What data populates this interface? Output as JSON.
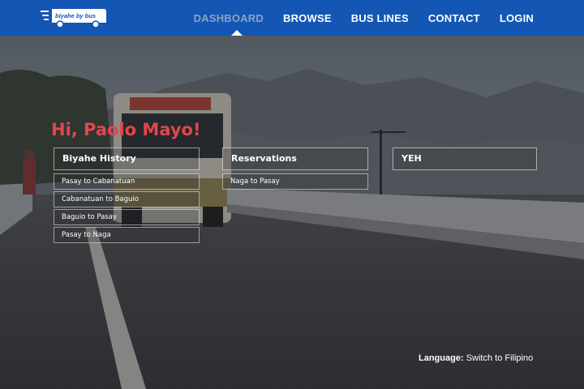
{
  "brand": {
    "logo_text": "biyahe by bus"
  },
  "nav": {
    "items": [
      {
        "label": "DASHBOARD",
        "active": true
      },
      {
        "label": "BROWSE",
        "active": false
      },
      {
        "label": "BUS LINES",
        "active": false
      },
      {
        "label": "CONTACT",
        "active": false
      },
      {
        "label": "LOGIN",
        "active": false
      }
    ]
  },
  "greeting": "Hi, Paolo Mayo!",
  "columns": [
    {
      "title": "Biyahe History",
      "items": [
        "Pasay to Cabanatuan",
        "Cabanatuan to Baguio",
        "Baguio to Pasay",
        "Pasay to Naga"
      ]
    },
    {
      "title": "Reservations",
      "items": [
        "Naga to Pasay"
      ]
    },
    {
      "title": "YEH",
      "items": []
    }
  ],
  "language": {
    "label": "Language:",
    "link": "Switch to Filipino"
  },
  "colors": {
    "navbar": "#1356b4",
    "greeting": "#e0474c",
    "nav_active": "#8aa3c3"
  }
}
